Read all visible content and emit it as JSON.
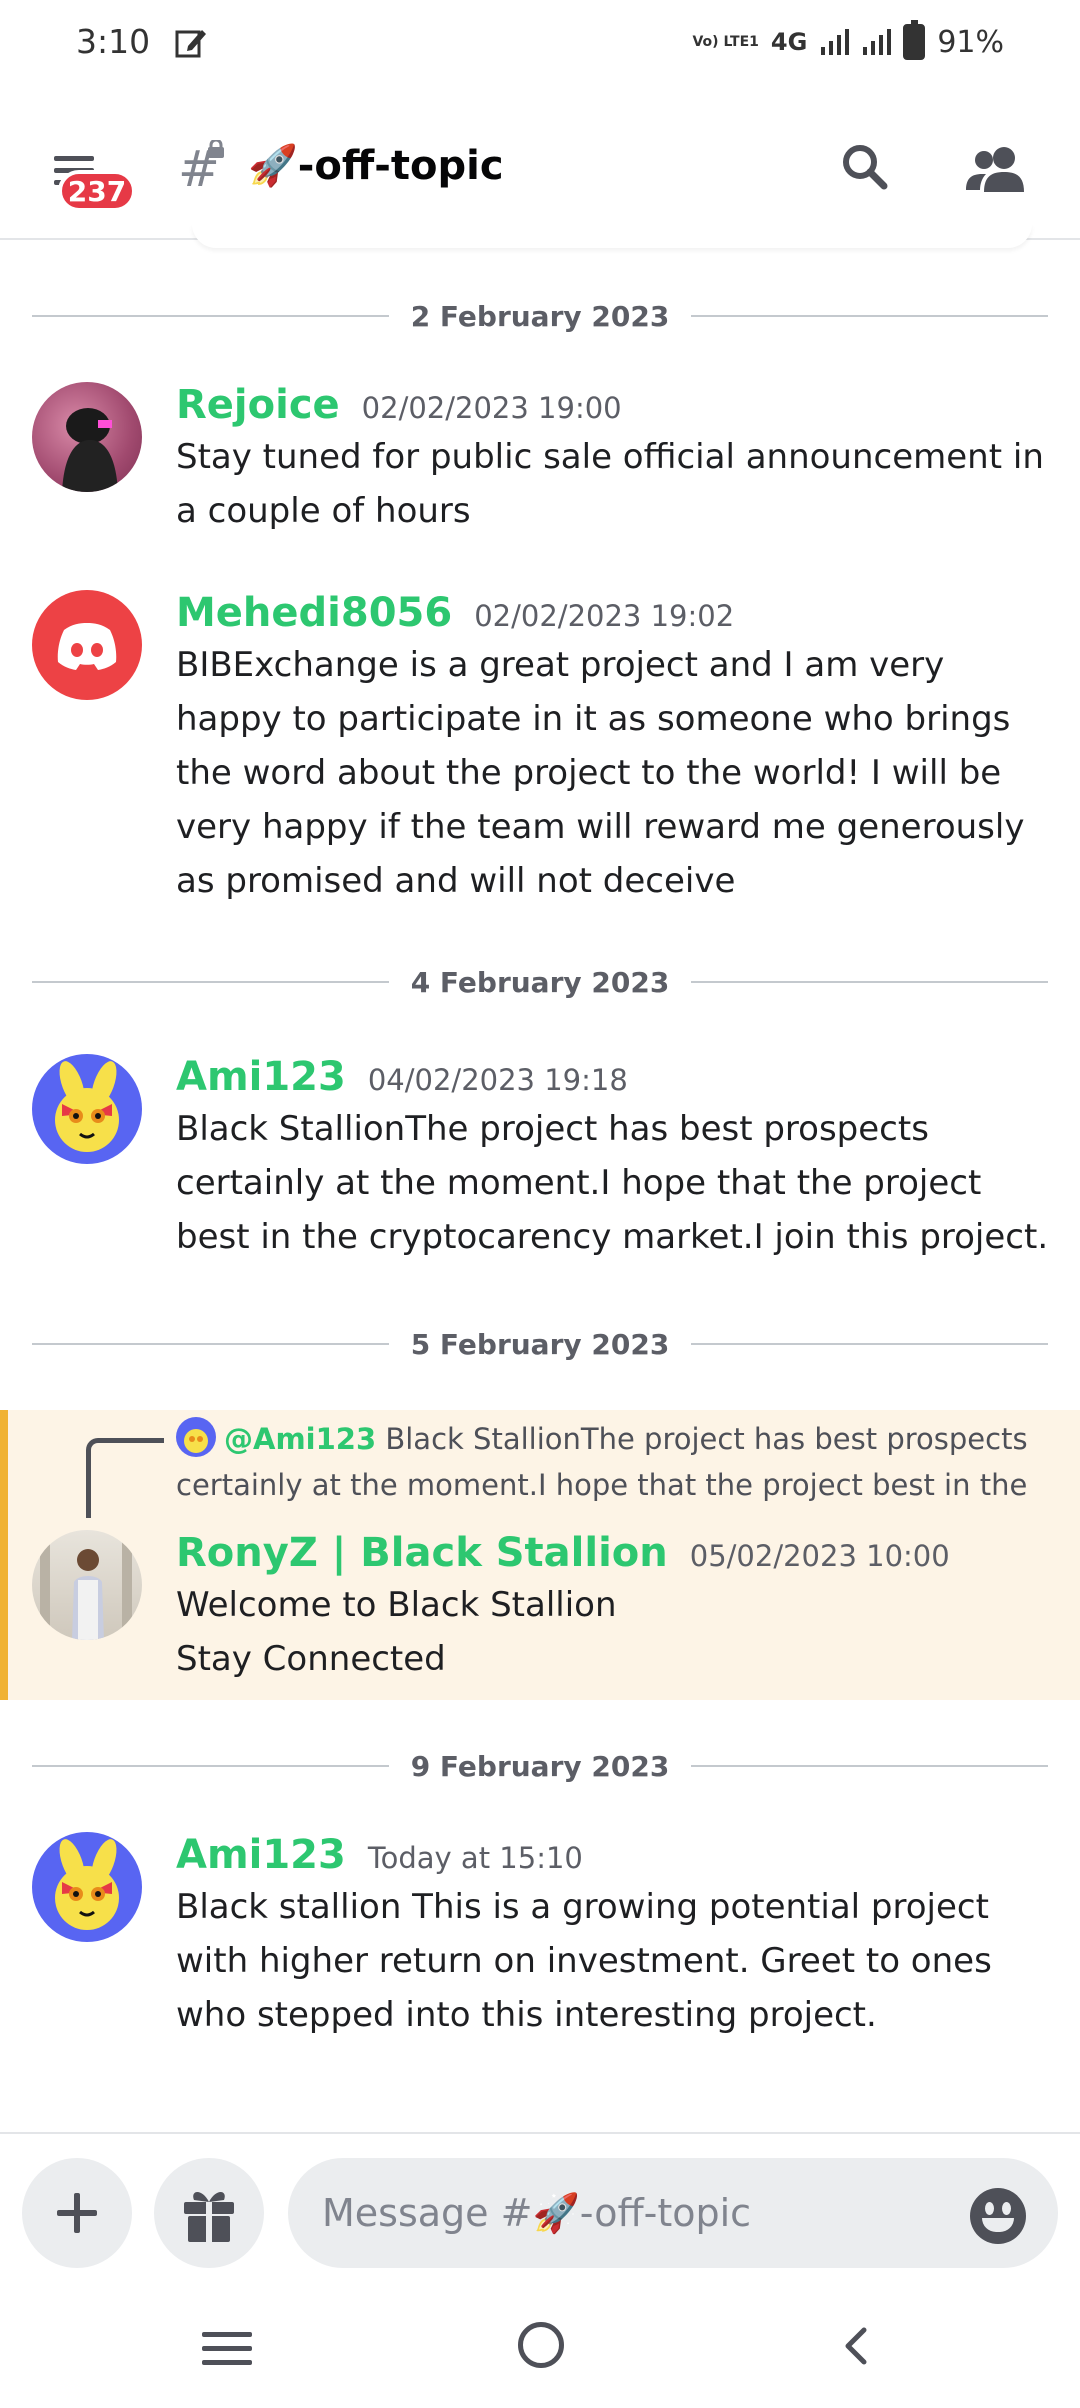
{
  "status_bar": {
    "time": "3:10",
    "network": "4G",
    "volte": "Vo) LTE1",
    "battery": "91%"
  },
  "header": {
    "unread_badge": "237",
    "channel_name": "🚀-off-topic"
  },
  "messages_list": [
    {
      "type": "divider",
      "label": "2 February 2023"
    },
    {
      "type": "message",
      "author": "Rejoice",
      "time": "02/02/2023 19:00",
      "text": "Stay tuned for public sale official announcement in a couple of hours"
    },
    {
      "type": "message",
      "author": "Mehedi8056",
      "time": "02/02/2023 19:02",
      "text": "BIBExchange is a great project and I am very happy to participate in it as someone who brings the word about the project to the world! I will be very happy if the team will reward me generously as promised and will not deceive"
    },
    {
      "type": "divider",
      "label": "4 February 2023"
    },
    {
      "type": "message",
      "author": "Ami123",
      "time": "04/02/2023 19:18",
      "text": "Black StallionThe project has best prospects certainly at the moment.I hope that the project best in the cryptocarency market.I join this project."
    },
    {
      "type": "divider",
      "label": "5 February 2023"
    },
    {
      "type": "message",
      "author": "RonyZ | Black Stallion",
      "time": "05/02/2023 10:00",
      "text_line1": "Welcome to Black Stallion",
      "text_line2": "Stay Connected",
      "reply_to": {
        "mention": "@Ami123",
        "preview": "Black StallionThe project has best prospects certainly at the moment.I hope that the project best in the"
      }
    },
    {
      "type": "divider",
      "label": "9 February 2023"
    },
    {
      "type": "message",
      "author": "Ami123",
      "time": "Today at 15:10",
      "text": "Black stallion This is a growing potential project with higher return on investment. Greet to ones who stepped into this interesting project."
    }
  ],
  "composer": {
    "placeholder": "Message #🚀-off-topic"
  },
  "colors": {
    "author_green": "#2dc770",
    "highlight_bg": "#fdf4e6",
    "highlight_bar": "#f0b232",
    "badge_red": "#e63946",
    "discord_red": "#ed4245",
    "blurple": "#5865f2"
  },
  "icons": [
    "edit-icon",
    "signal-icon",
    "battery-icon",
    "menu-icon",
    "hash-lock-icon",
    "search-icon",
    "members-icon",
    "plus-icon",
    "gift-icon",
    "emoji-icon",
    "recents-icon",
    "home-icon",
    "back-icon"
  ]
}
